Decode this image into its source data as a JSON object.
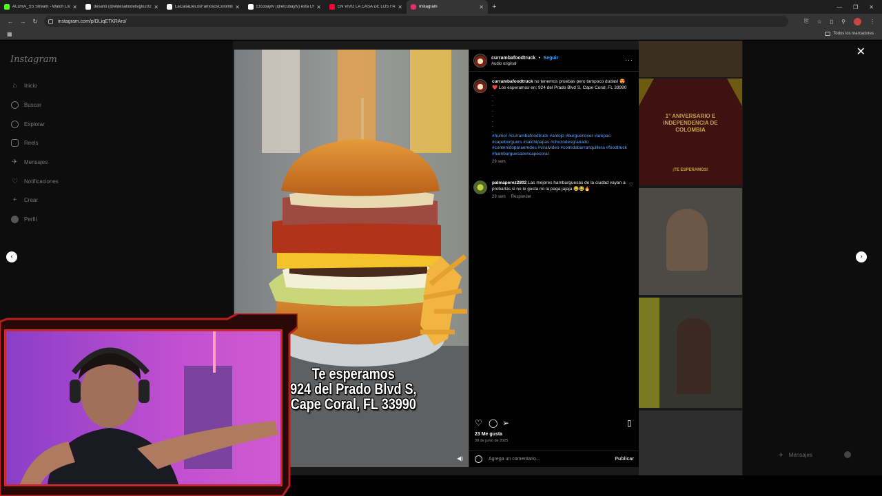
{
  "browser": {
    "tabs": [
      {
        "label": "ALDRA_SS Stream - Watch Live",
        "favicon_color": "#53fc18"
      },
      {
        "label": "desafio (@eldesafiodelsiglo2024)",
        "favicon_color": "#ffffff"
      },
      {
        "label": "LaCasaDeLosFamososColombia",
        "favicon_color": "#ffffff"
      },
      {
        "label": "Elcubaytv (@elcubaytv) está LIVE",
        "favicon_color": "#ffffff"
      },
      {
        "label": "EN VIVO LA CASA DE LOS FAMOSOS",
        "favicon_color": "#ff0033"
      },
      {
        "label": "Instagram",
        "favicon_color": "#e1306c"
      }
    ],
    "url": "instagram.com/p/DLiqETKRAro/",
    "bookmarks_all": "Todos los marcadores"
  },
  "instagram": {
    "logo": "Instagram",
    "nav": [
      {
        "label": "Inicio",
        "icon": "home-icon"
      },
      {
        "label": "Buscar",
        "icon": "search-icon"
      },
      {
        "label": "Explorar",
        "icon": "explore-icon"
      },
      {
        "label": "Reels",
        "icon": "reels-icon"
      },
      {
        "label": "Mensajes",
        "icon": "messages-icon"
      },
      {
        "label": "Notificaciones",
        "icon": "heart-icon"
      },
      {
        "label": "Crear",
        "icon": "plus-icon"
      },
      {
        "label": "Perfil",
        "icon": "profile-avatar"
      }
    ],
    "messages_bar": "Mensajes"
  },
  "post": {
    "username": "currambafoodtruck",
    "follow": "Seguir",
    "audio": "Audio original",
    "caption_text": "no tenemos pruebas pero tampoco dudas! 😍❤️ Los esperamos en: 924 del Prado Blvd S, Cape Coral, FL 33990",
    "caption_dots": ".\n.\n.\n.\n.\n.\n.\n.",
    "hashtags": "#humor #currambafoodtruck #antojo #burguerlover #arepas #capeburguers #salchipapas #chuzodesgranado #contenidoparaeredes #viralvideo #comidabarranquillera #foodtruck #hamburguesasencapecoral",
    "caption_time": "29 sem",
    "comment_user": "palmaperez2802",
    "comment_text": "Las mejores hamburguesas de la ciudad vayan a probarlas si no le gusta no la paga jajaja 😂😂🔥",
    "comment_time": "29 sem",
    "reply": "Responder",
    "likes": "23 Me gusta",
    "date": "30 de junio de 2025",
    "add_comment_placeholder": "Agrega un comentario...",
    "publish": "Publicar",
    "overlay_line1": "Te esperamos",
    "overlay_line2": "924 del Prado Blvd S,",
    "overlay_line3": "Cape Coral, FL 33990"
  },
  "grid": {
    "promo_title": "1° ANIVERSARIO E INDEPENDENCIA DE COLOMBIA",
    "promo_sub": "¡TE ESPERAMOS!"
  },
  "colors": {
    "accent_link": "#4aa3f5",
    "hashtag": "#6aa7ff",
    "cam_border": "#c82a2a"
  }
}
